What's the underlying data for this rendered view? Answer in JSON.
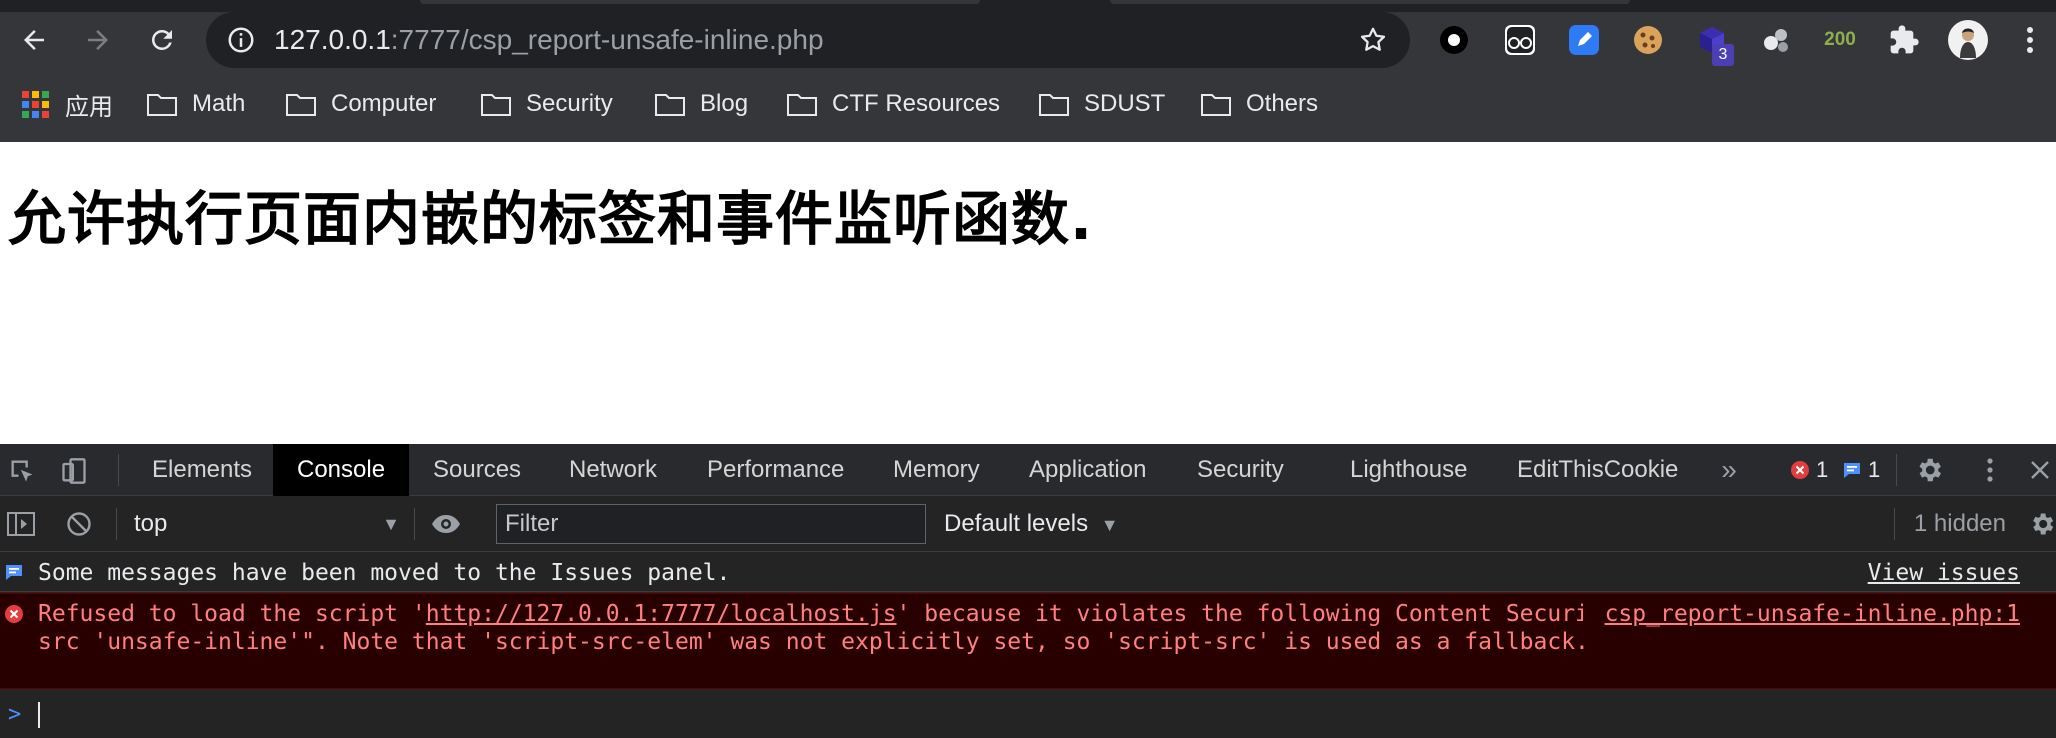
{
  "browser": {
    "url_host": "127.0.0.1",
    "url_path": ":7777/csp_report-unsafe-inline.php",
    "extension_badge": "3",
    "extension_200_label": "200"
  },
  "bookmarks": {
    "apps_label": "应用",
    "folders": [
      "Math",
      "Computer",
      "Security",
      "Blog",
      "CTF Resources",
      "SDUST",
      "Others"
    ]
  },
  "page": {
    "heading": "允许执行页面内嵌的标签和事件监听函数."
  },
  "devtools": {
    "tabs": [
      "Elements",
      "Console",
      "Sources",
      "Network",
      "Performance",
      "Memory",
      "Application",
      "Security",
      "Lighthouse",
      "EditThisCookie"
    ],
    "active_tab": "Console",
    "error_count": "1",
    "info_count": "1",
    "context": "top",
    "filter_placeholder": "Filter",
    "levels": "Default levels",
    "hidden": "1 hidden",
    "colors": {
      "error_bg": "#290000",
      "error_text": "#ff8080",
      "error_icon": "#e33e3e",
      "info_icon": "#4d90fe"
    }
  },
  "console": {
    "info_message": "Some messages have been moved to the Issues panel.",
    "info_link": "View issues",
    "error_prefix": "Refused to load the script '",
    "error_url": "http://127.0.0.1:7777/localhost.js",
    "error_suffix": "' because it violates the following Content Security Policy directive: \"script-src 'unsafe-inline'\". Note that 'script-src-elem' was not explicitly set, so 'script-src' is used as a fallback.",
    "error_source": "csp_report-unsafe-inline.php:1",
    "prompt": ">"
  }
}
